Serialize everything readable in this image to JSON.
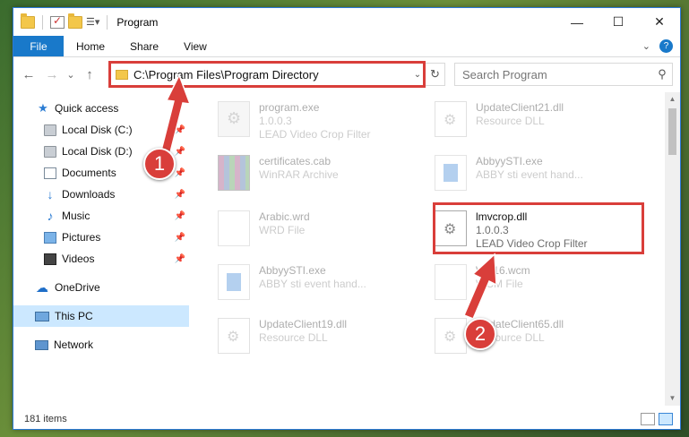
{
  "window": {
    "title": "Program",
    "controls": [
      "—",
      "☐",
      "✕"
    ]
  },
  "ribbon": {
    "file": "File",
    "tabs": [
      "Home",
      "Share",
      "View"
    ]
  },
  "nav": {
    "back": "←",
    "forward": "→",
    "recent": "⌄",
    "up": "↑"
  },
  "address": {
    "path": "C:\\Program Files\\Program Directory",
    "dropdown": "⌄",
    "refresh": "↻"
  },
  "search": {
    "placeholder": "Search Program",
    "icon": "search-icon"
  },
  "sidebar": {
    "items": [
      {
        "label": "Quick access",
        "icon": "star-icon",
        "pinned": false
      },
      {
        "label": "Local Disk (C:)",
        "icon": "disk-icon",
        "pinned": true
      },
      {
        "label": "Local Disk (D:)",
        "icon": "disk-icon",
        "pinned": true
      },
      {
        "label": "Documents",
        "icon": "document-icon",
        "pinned": true
      },
      {
        "label": "Downloads",
        "icon": "download-icon",
        "pinned": true
      },
      {
        "label": "Music",
        "icon": "music-icon",
        "pinned": true
      },
      {
        "label": "Pictures",
        "icon": "picture-icon",
        "pinned": true
      },
      {
        "label": "Videos",
        "icon": "video-icon",
        "pinned": true
      },
      {
        "label": "OneDrive",
        "icon": "cloud-icon",
        "pinned": false
      },
      {
        "label": "This PC",
        "icon": "computer-icon",
        "pinned": false,
        "selected": true
      },
      {
        "label": "Network",
        "icon": "network-icon",
        "pinned": false
      }
    ]
  },
  "files": [
    {
      "name": "program.exe",
      "line2": "1.0.0.3",
      "line3": "LEAD Video Crop Filter",
      "type": "exe",
      "faded": true
    },
    {
      "name": "UpdateClient21.dll",
      "line2": "Resource DLL",
      "line3": "",
      "type": "dll",
      "faded": true
    },
    {
      "name": "certificates.cab",
      "line2": "WinRAR Archive",
      "line3": "",
      "type": "cab",
      "faded": true
    },
    {
      "name": "AbbyySTI.exe",
      "line2": "ABBY sti event hand...",
      "line3": "",
      "type": "sti",
      "faded": true
    },
    {
      "name": "Arabic.wrd",
      "line2": "WRD File",
      "line3": "",
      "type": "blank",
      "faded": true
    },
    {
      "name": "lmvcrop.dll",
      "line2": "1.0.0.3",
      "line3": "LEAD Video Crop Filter",
      "type": "dll",
      "faded": false
    },
    {
      "name": "AbbyySTI.exe",
      "line2": "ABBY sti event hand...",
      "line3": "",
      "type": "sti",
      "faded": true
    },
    {
      "name": "WP16.wcm",
      "line2": "WCM File",
      "line3": "",
      "type": "blank",
      "faded": true
    },
    {
      "name": "UpdateClient19.dll",
      "line2": "Resource DLL",
      "line3": "",
      "type": "dll",
      "faded": true
    },
    {
      "name": "UpdateClient65.dll",
      "line2": "Resource DLL",
      "line3": "",
      "type": "dll",
      "faded": true
    }
  ],
  "status": {
    "count": "181 items"
  },
  "annotations": {
    "badge1": "1",
    "badge2": "2",
    "color": "#d93e3a"
  },
  "colors": {
    "accent": "#1979ca",
    "highlight": "#d93e3a",
    "selection": "#cce8ff"
  }
}
